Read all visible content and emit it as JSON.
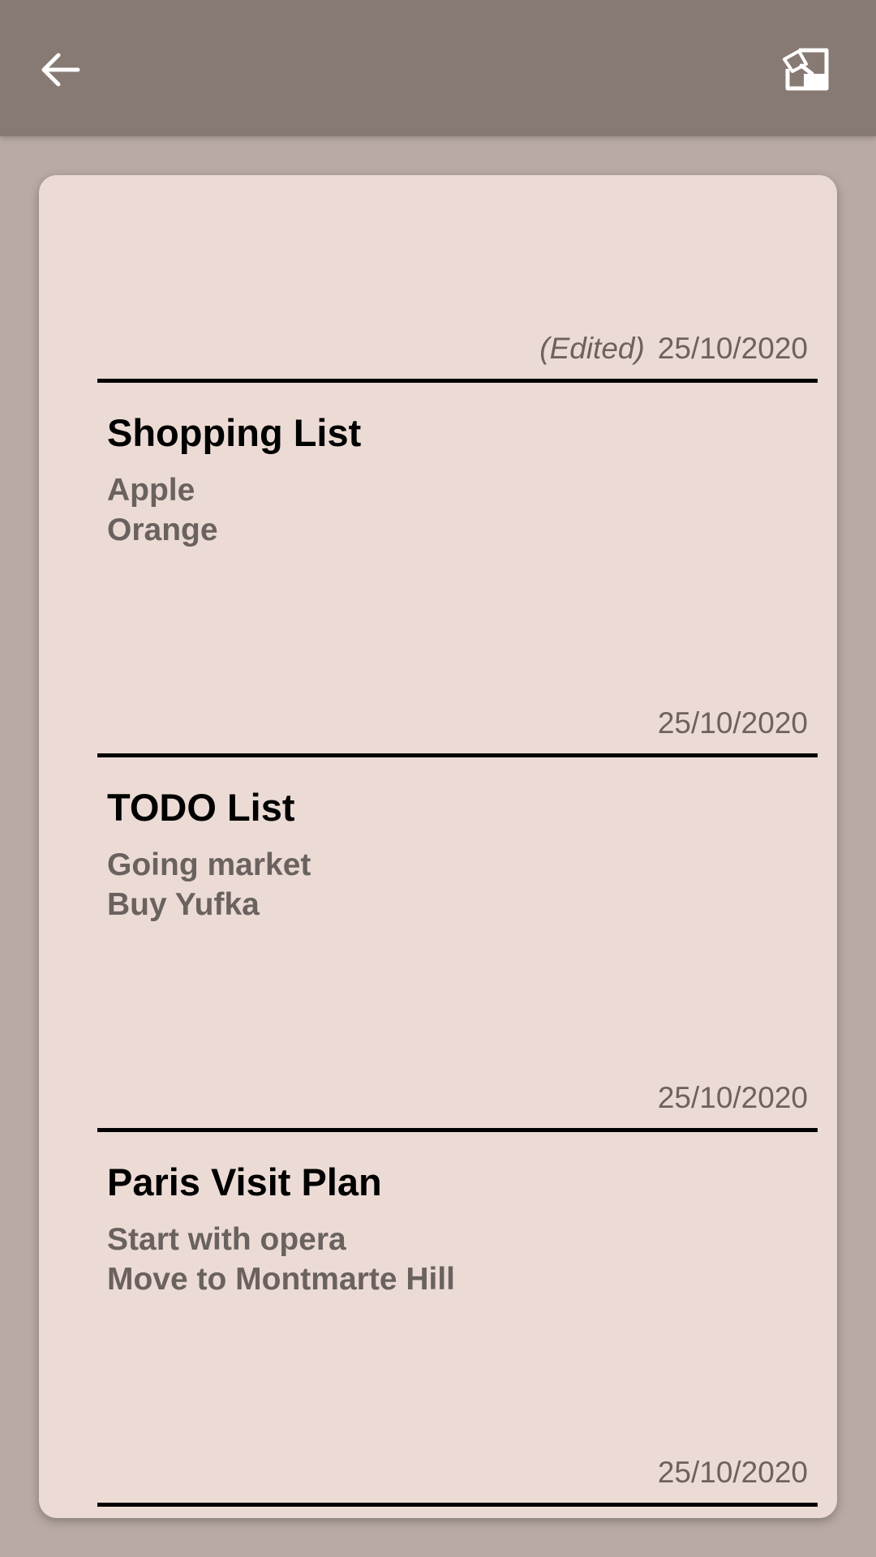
{
  "header": {
    "back_icon": "arrow-left-icon",
    "export_icon": "export-note-icon",
    "background": "#877a73"
  },
  "current_note": {
    "edited_label": "(Edited)",
    "date": "25/10/2020"
  },
  "notes": [
    {
      "title": "Shopping List",
      "lines": [
        "Apple",
        "Orange"
      ],
      "date": "25/10/2020"
    },
    {
      "title": "TODO List",
      "lines": [
        "Going market",
        "Buy Yufka"
      ],
      "date": "25/10/2020"
    },
    {
      "title": "Paris Visit Plan",
      "lines": [
        "Start with opera",
        "Move to Montmarte Hill"
      ],
      "date": "25/10/2020"
    }
  ],
  "colors": {
    "page_background": "#b9aaa3",
    "card_background": "#ecdbd5",
    "secondary_text": "#6a625e"
  }
}
